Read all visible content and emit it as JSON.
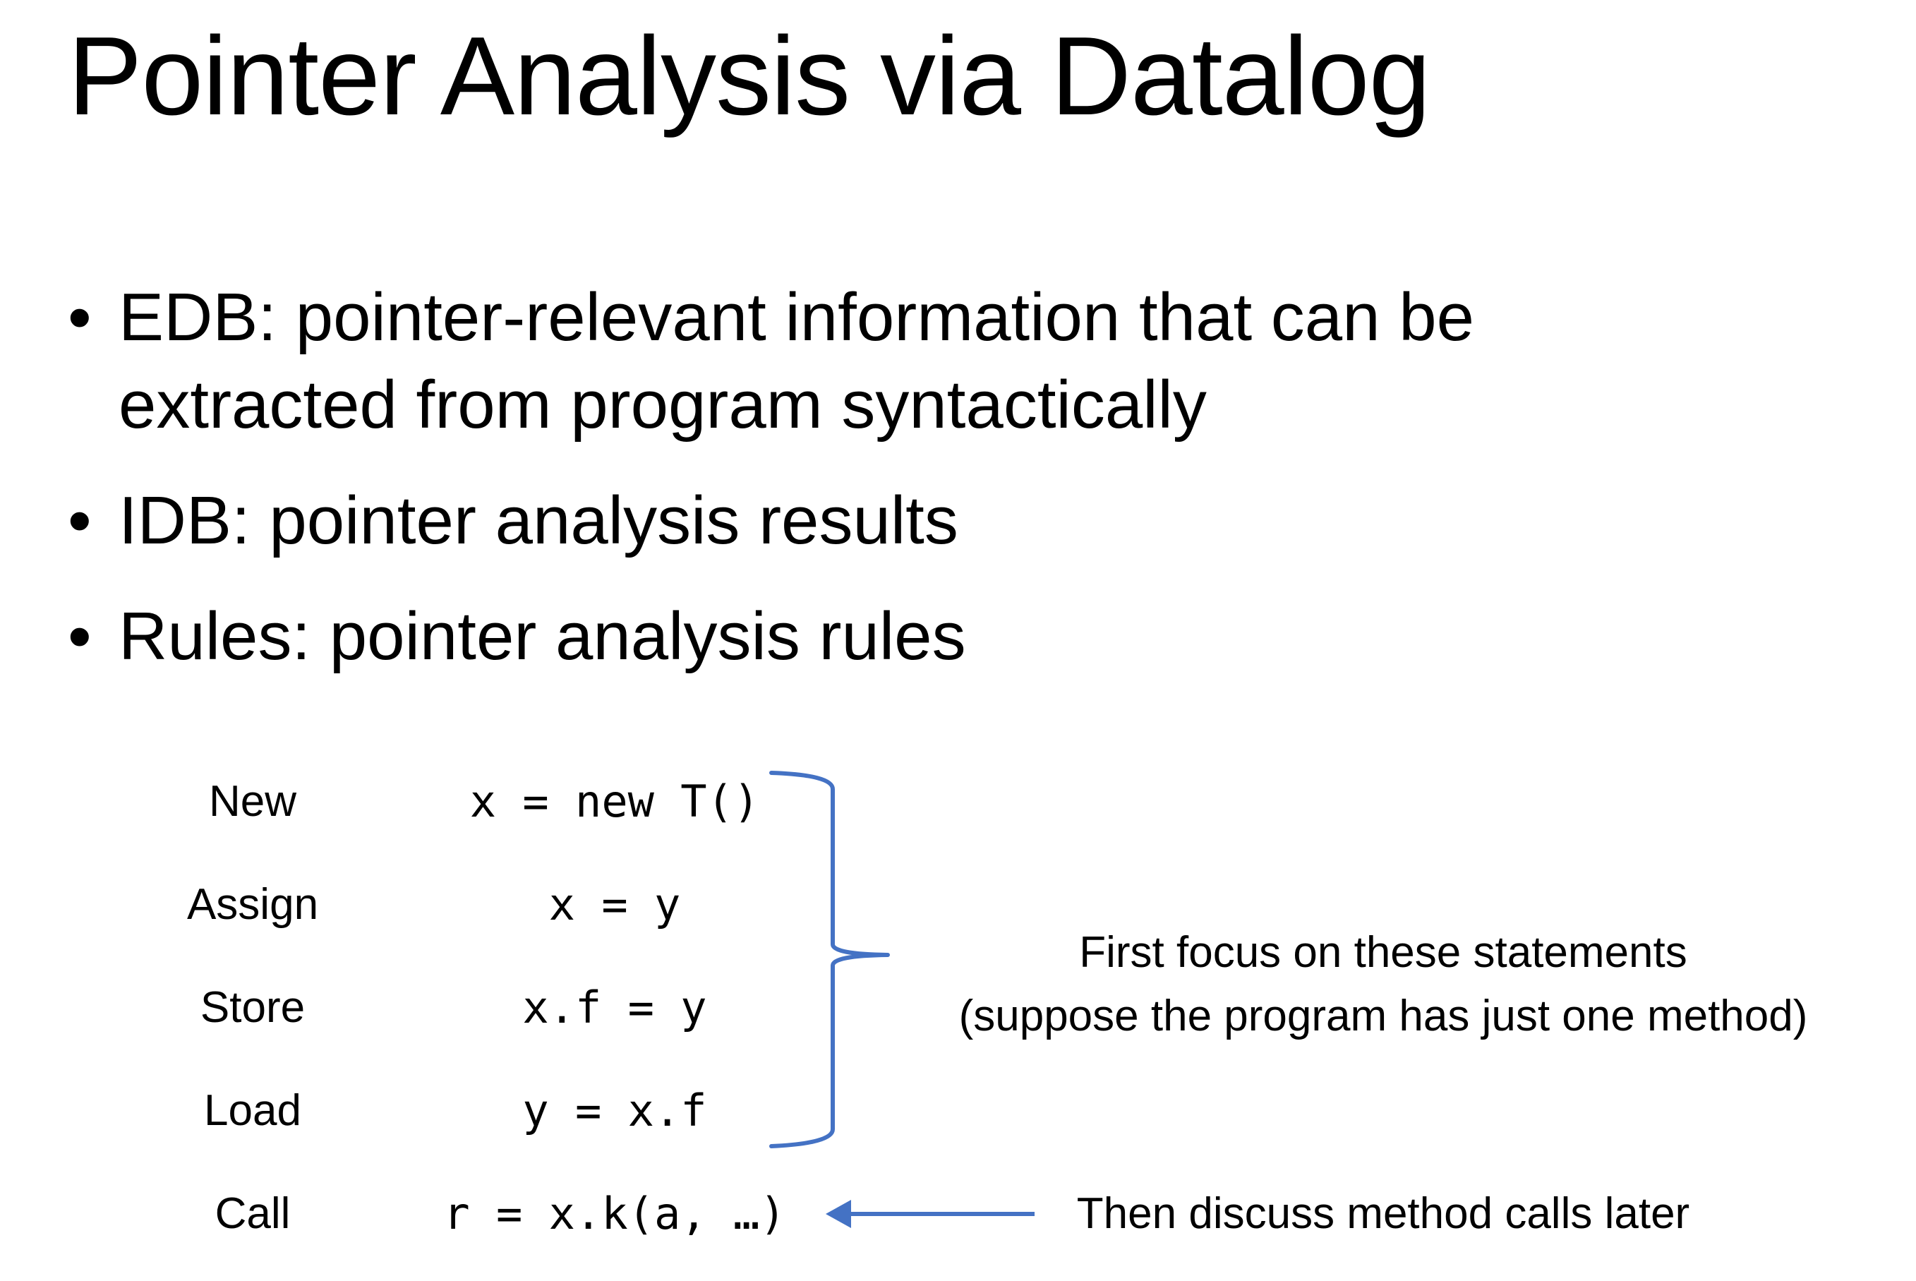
{
  "slide": {
    "title": "Pointer Analysis via Datalog",
    "bullets": [
      {
        "marker": "•",
        "lines": [
          "EDB: pointer-relevant information that can be",
          "extracted from program syntactically"
        ]
      },
      {
        "marker": "•",
        "lines": [
          "IDB: pointer analysis results"
        ]
      },
      {
        "marker": "•",
        "lines": [
          "Rules: pointer analysis rules"
        ]
      }
    ]
  },
  "statements": [
    {
      "kind": "New",
      "code": "x = new T()"
    },
    {
      "kind": "Assign",
      "code": "x = y"
    },
    {
      "kind": "Store",
      "code": "x.f = y"
    },
    {
      "kind": "Load",
      "code": "y = x.f"
    },
    {
      "kind": "Call",
      "code": "r = x.k(a, …)"
    }
  ],
  "notes": {
    "focus": [
      "First focus on these statements",
      "(suppose the program has just one method)"
    ],
    "later": "Then discuss method calls later"
  },
  "colors": {
    "brace": "#4472C4",
    "arrow": "#4472C4",
    "text": "#000000"
  }
}
